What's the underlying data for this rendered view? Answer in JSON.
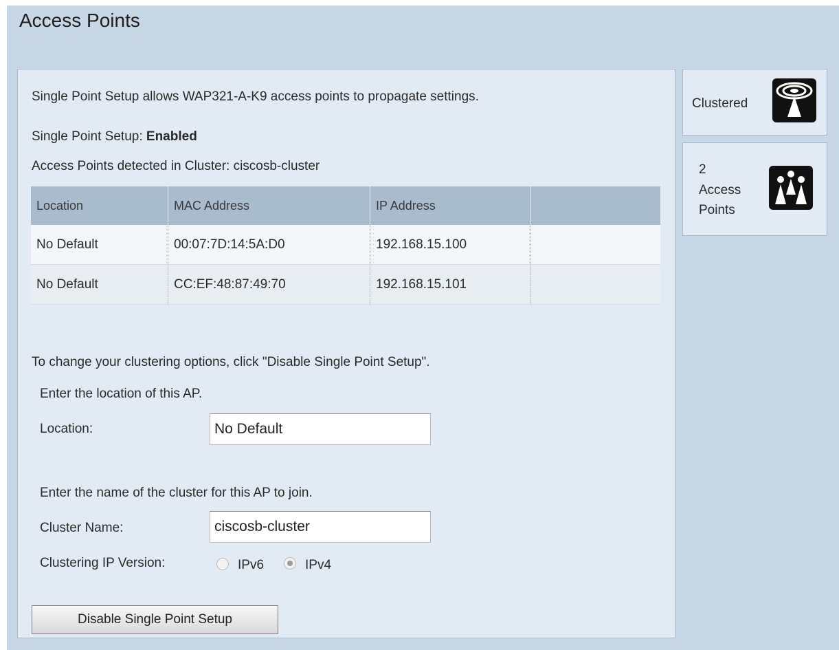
{
  "page": {
    "title": "Access Points"
  },
  "intro": {
    "description": "Single Point Setup allows WAP321-A-K9 access points to propagate settings.",
    "status_label": "Single Point Setup:",
    "status_value": "Enabled",
    "cluster_detected": "Access Points detected in Cluster: ciscosb-cluster"
  },
  "table": {
    "columns": [
      "Location",
      "MAC Address",
      "IP Address",
      ""
    ],
    "rows": [
      {
        "location": "No Default",
        "mac": "00:07:7D:14:5A:D0",
        "ip": "192.168.15.100"
      },
      {
        "location": "No Default",
        "mac": "CC:EF:48:87:49:70",
        "ip": "192.168.15.101"
      }
    ]
  },
  "config": {
    "change_hint": "To change your clustering options, click \"Disable Single Point Setup\".",
    "location_prompt": "Enter the location of this AP.",
    "location_label": "Location:",
    "location_value": "No Default",
    "cluster_prompt": "Enter the name of the cluster for this AP to join.",
    "cluster_label": "Cluster Name:",
    "cluster_value": "ciscosb-cluster",
    "ip_version_label": "Clustering IP Version:",
    "ip_options": [
      {
        "label": "IPv6",
        "selected": false
      },
      {
        "label": "IPv4",
        "selected": true
      }
    ],
    "disable_button": "Disable Single Point Setup"
  },
  "sidebar": {
    "clustered": {
      "label": "Clustered",
      "icon": "clustered-icon"
    },
    "access_points": {
      "count": "2",
      "line1": "Access",
      "line2": "Points",
      "icon": "access-points-icon"
    }
  },
  "colors": {
    "page_bg": "#c7d7e6",
    "panel_bg": "#e2eaf3",
    "table_header": "#a9bcce",
    "icon_bg": "#111111"
  }
}
